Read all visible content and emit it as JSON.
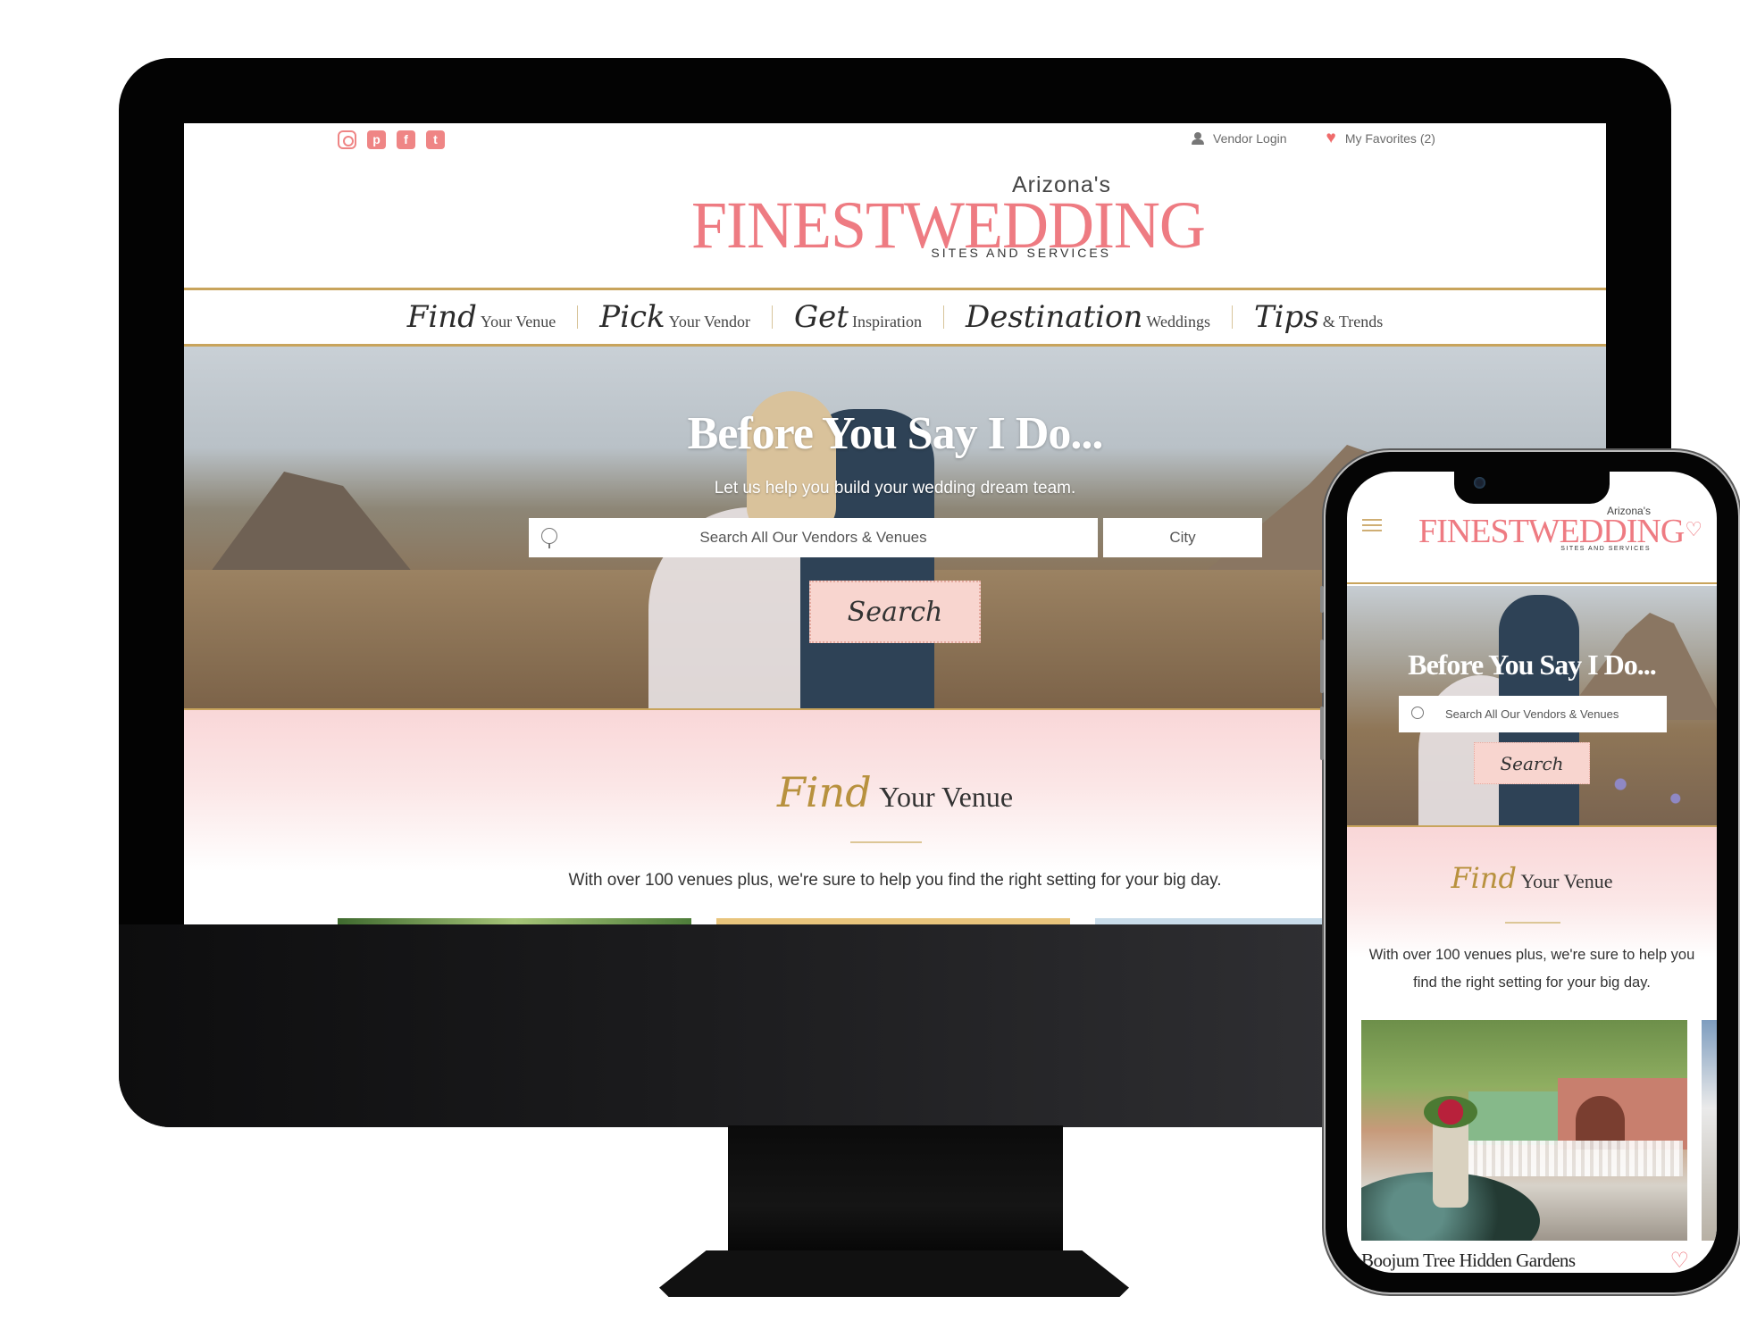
{
  "desktop": {
    "social_icons": [
      {
        "name": "instagram-icon",
        "glyph": ""
      },
      {
        "name": "pinterest-icon",
        "glyph": "p"
      },
      {
        "name": "facebook-icon",
        "glyph": "f"
      },
      {
        "name": "twitter-icon",
        "glyph": "t"
      }
    ],
    "utility": {
      "vendor_login": "Vendor Login",
      "favorites": "My Favorites (2)",
      "heart_glyph": "♥"
    },
    "logo": {
      "prefix": "Arizona's",
      "main": "FINESTWEDDING",
      "sub": "SITES AND SERVICES"
    },
    "nav": [
      {
        "script": "Find",
        "plain": "Your Venue"
      },
      {
        "script": "Pick",
        "plain": "Your Vendor"
      },
      {
        "script": "Get",
        "plain": "Inspiration"
      },
      {
        "script": "Destination",
        "plain": "Weddings"
      },
      {
        "script": "Tips",
        "plain": "& Trends"
      }
    ],
    "hero": {
      "title": "Before You Say I Do...",
      "subtitle": "Let us help you build your wedding dream team.",
      "search_placeholder": "Search All Our Vendors & Venues",
      "city_placeholder": "City",
      "search_button": "Search"
    },
    "find": {
      "script": "Find",
      "plain": "Your Venue",
      "text": "With over 100 venues plus, we're sure to help you find the right setting for your big day."
    }
  },
  "mobile": {
    "logo": {
      "prefix": "Arizona's",
      "main": "FINESTWEDDING",
      "sub": "SITES AND SERVICES"
    },
    "heart_glyph": "♡",
    "hero": {
      "title": "Before You Say I Do...",
      "search_placeholder": "Search All Our Vendors & Venues",
      "search_button": "Search"
    },
    "find": {
      "script": "Find",
      "plain": "Your Venue",
      "text": "With over 100 venues plus, we're sure to help you find the right setting for your big day."
    },
    "venue_card": {
      "name": "Boojum Tree Hidden Gardens",
      "heart_glyph": "♡"
    }
  },
  "colors": {
    "brand_pink": "#ee7b82",
    "gold": "#c8a45c",
    "button_pink": "#f8d5cf",
    "social_coral": "#ef8585"
  }
}
